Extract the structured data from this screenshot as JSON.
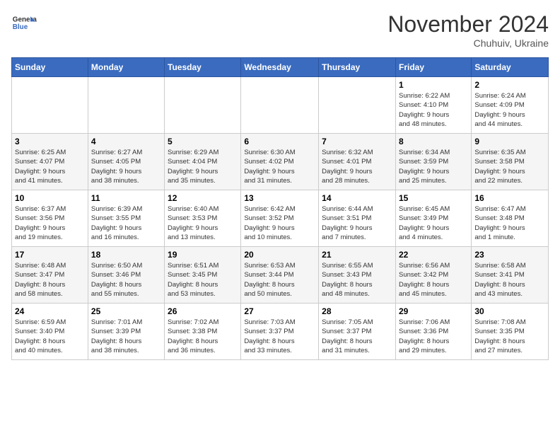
{
  "logo": {
    "line1": "General",
    "line2": "Blue"
  },
  "header": {
    "month": "November 2024",
    "location": "Chuhuiv, Ukraine"
  },
  "weekdays": [
    "Sunday",
    "Monday",
    "Tuesday",
    "Wednesday",
    "Thursday",
    "Friday",
    "Saturday"
  ],
  "weeks": [
    [
      {
        "day": "",
        "detail": ""
      },
      {
        "day": "",
        "detail": ""
      },
      {
        "day": "",
        "detail": ""
      },
      {
        "day": "",
        "detail": ""
      },
      {
        "day": "",
        "detail": ""
      },
      {
        "day": "1",
        "detail": "Sunrise: 6:22 AM\nSunset: 4:10 PM\nDaylight: 9 hours\nand 48 minutes."
      },
      {
        "day": "2",
        "detail": "Sunrise: 6:24 AM\nSunset: 4:09 PM\nDaylight: 9 hours\nand 44 minutes."
      }
    ],
    [
      {
        "day": "3",
        "detail": "Sunrise: 6:25 AM\nSunset: 4:07 PM\nDaylight: 9 hours\nand 41 minutes."
      },
      {
        "day": "4",
        "detail": "Sunrise: 6:27 AM\nSunset: 4:05 PM\nDaylight: 9 hours\nand 38 minutes."
      },
      {
        "day": "5",
        "detail": "Sunrise: 6:29 AM\nSunset: 4:04 PM\nDaylight: 9 hours\nand 35 minutes."
      },
      {
        "day": "6",
        "detail": "Sunrise: 6:30 AM\nSunset: 4:02 PM\nDaylight: 9 hours\nand 31 minutes."
      },
      {
        "day": "7",
        "detail": "Sunrise: 6:32 AM\nSunset: 4:01 PM\nDaylight: 9 hours\nand 28 minutes."
      },
      {
        "day": "8",
        "detail": "Sunrise: 6:34 AM\nSunset: 3:59 PM\nDaylight: 9 hours\nand 25 minutes."
      },
      {
        "day": "9",
        "detail": "Sunrise: 6:35 AM\nSunset: 3:58 PM\nDaylight: 9 hours\nand 22 minutes."
      }
    ],
    [
      {
        "day": "10",
        "detail": "Sunrise: 6:37 AM\nSunset: 3:56 PM\nDaylight: 9 hours\nand 19 minutes."
      },
      {
        "day": "11",
        "detail": "Sunrise: 6:39 AM\nSunset: 3:55 PM\nDaylight: 9 hours\nand 16 minutes."
      },
      {
        "day": "12",
        "detail": "Sunrise: 6:40 AM\nSunset: 3:53 PM\nDaylight: 9 hours\nand 13 minutes."
      },
      {
        "day": "13",
        "detail": "Sunrise: 6:42 AM\nSunset: 3:52 PM\nDaylight: 9 hours\nand 10 minutes."
      },
      {
        "day": "14",
        "detail": "Sunrise: 6:44 AM\nSunset: 3:51 PM\nDaylight: 9 hours\nand 7 minutes."
      },
      {
        "day": "15",
        "detail": "Sunrise: 6:45 AM\nSunset: 3:49 PM\nDaylight: 9 hours\nand 4 minutes."
      },
      {
        "day": "16",
        "detail": "Sunrise: 6:47 AM\nSunset: 3:48 PM\nDaylight: 9 hours\nand 1 minute."
      }
    ],
    [
      {
        "day": "17",
        "detail": "Sunrise: 6:48 AM\nSunset: 3:47 PM\nDaylight: 8 hours\nand 58 minutes."
      },
      {
        "day": "18",
        "detail": "Sunrise: 6:50 AM\nSunset: 3:46 PM\nDaylight: 8 hours\nand 55 minutes."
      },
      {
        "day": "19",
        "detail": "Sunrise: 6:51 AM\nSunset: 3:45 PM\nDaylight: 8 hours\nand 53 minutes."
      },
      {
        "day": "20",
        "detail": "Sunrise: 6:53 AM\nSunset: 3:44 PM\nDaylight: 8 hours\nand 50 minutes."
      },
      {
        "day": "21",
        "detail": "Sunrise: 6:55 AM\nSunset: 3:43 PM\nDaylight: 8 hours\nand 48 minutes."
      },
      {
        "day": "22",
        "detail": "Sunrise: 6:56 AM\nSunset: 3:42 PM\nDaylight: 8 hours\nand 45 minutes."
      },
      {
        "day": "23",
        "detail": "Sunrise: 6:58 AM\nSunset: 3:41 PM\nDaylight: 8 hours\nand 43 minutes."
      }
    ],
    [
      {
        "day": "24",
        "detail": "Sunrise: 6:59 AM\nSunset: 3:40 PM\nDaylight: 8 hours\nand 40 minutes."
      },
      {
        "day": "25",
        "detail": "Sunrise: 7:01 AM\nSunset: 3:39 PM\nDaylight: 8 hours\nand 38 minutes."
      },
      {
        "day": "26",
        "detail": "Sunrise: 7:02 AM\nSunset: 3:38 PM\nDaylight: 8 hours\nand 36 minutes."
      },
      {
        "day": "27",
        "detail": "Sunrise: 7:03 AM\nSunset: 3:37 PM\nDaylight: 8 hours\nand 33 minutes."
      },
      {
        "day": "28",
        "detail": "Sunrise: 7:05 AM\nSunset: 3:37 PM\nDaylight: 8 hours\nand 31 minutes."
      },
      {
        "day": "29",
        "detail": "Sunrise: 7:06 AM\nSunset: 3:36 PM\nDaylight: 8 hours\nand 29 minutes."
      },
      {
        "day": "30",
        "detail": "Sunrise: 7:08 AM\nSunset: 3:35 PM\nDaylight: 8 hours\nand 27 minutes."
      }
    ]
  ]
}
